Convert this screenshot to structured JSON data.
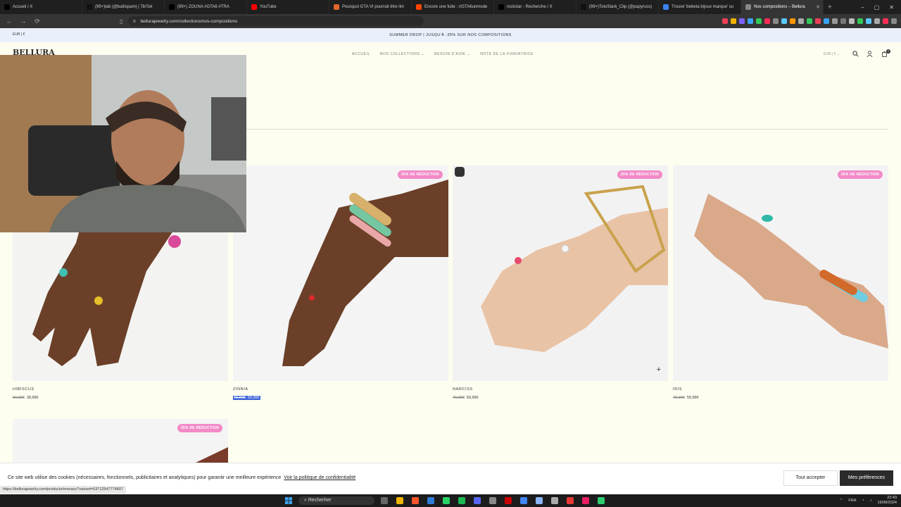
{
  "browser": {
    "tabs": [
      {
        "title": "Accueil / X",
        "color": "#000000"
      },
      {
        "title": "(99+)tati (@baltispam) | TikTok",
        "color": "#111111"
      },
      {
        "title": "(99+) ZOUNA #GTA6 #TRA",
        "color": "#000000"
      },
      {
        "title": "YouTube",
        "color": "#ff0000"
      },
      {
        "title": "Pourquoi GTA VI pourrait être lim",
        "color": "#e0662d"
      },
      {
        "title": "Encore une fuite : r/GTA6unmode",
        "color": "#ff4500"
      },
      {
        "title": "rockstar - Recherche / X",
        "color": "#000000"
      },
      {
        "title": "(99+)TotoStark_Clip (@papyruss)",
        "color": "#111111"
      },
      {
        "title": "Trouvé 'bebeta bijoux marque' su",
        "color": "#3b82f6"
      },
      {
        "title": "Nos compositions – Bellura",
        "color": "#888888",
        "active": true
      }
    ],
    "url": "bellurajewelry.com/collections/nos-compositions"
  },
  "site": {
    "promo_currency": "EUR | €",
    "promo_text": "SUMMER DROP | JUSQU'À -35% SUR NOS COMPOSITIONS",
    "logo": "BELLURA",
    "nav": [
      "ACCUEIL",
      "NOS COLLECTIONS ⌄",
      "BESOIN D'AIDE ⌄",
      "NOTE DE LA FONDATRICE"
    ],
    "currency": "EUR | € ⌄",
    "cart_count": "0"
  },
  "products": [
    {
      "name": "HIBISCUS",
      "old": "59,99€",
      "price": "39,99€",
      "badge": ""
    },
    {
      "name": "ZINNIA",
      "old": "79,99€",
      "price": "59,99€",
      "badge": "25% DE RÉDUCTION",
      "selected": true
    },
    {
      "name": "NARCISS",
      "old": "79,99€",
      "price": "59,99€",
      "badge": "25% DE RÉDUCTION"
    },
    {
      "name": "IRIS",
      "old": "79,99€",
      "price": "59,99€",
      "badge": "25% DE RÉDUCTION"
    },
    {
      "name": "",
      "old": "",
      "price": "",
      "badge": "35% DE RÉDUCTION"
    }
  ],
  "cookie": {
    "text": "Ce site web utilise des cookies (nécessaires, fonctionnels, publicitaires et analytiques) pour garantir une meilleure expérience",
    "link": "Voir la politique de confidentialité",
    "accept": "Tout accepter",
    "prefs": "Mes préférences"
  },
  "status_url": "https://bellurajewelry.com/products/monaco?variant=53712547774807",
  "taskbar": {
    "search": "Recherher",
    "lang": "FRA",
    "time": "22:43",
    "date": "19/08/2024"
  }
}
